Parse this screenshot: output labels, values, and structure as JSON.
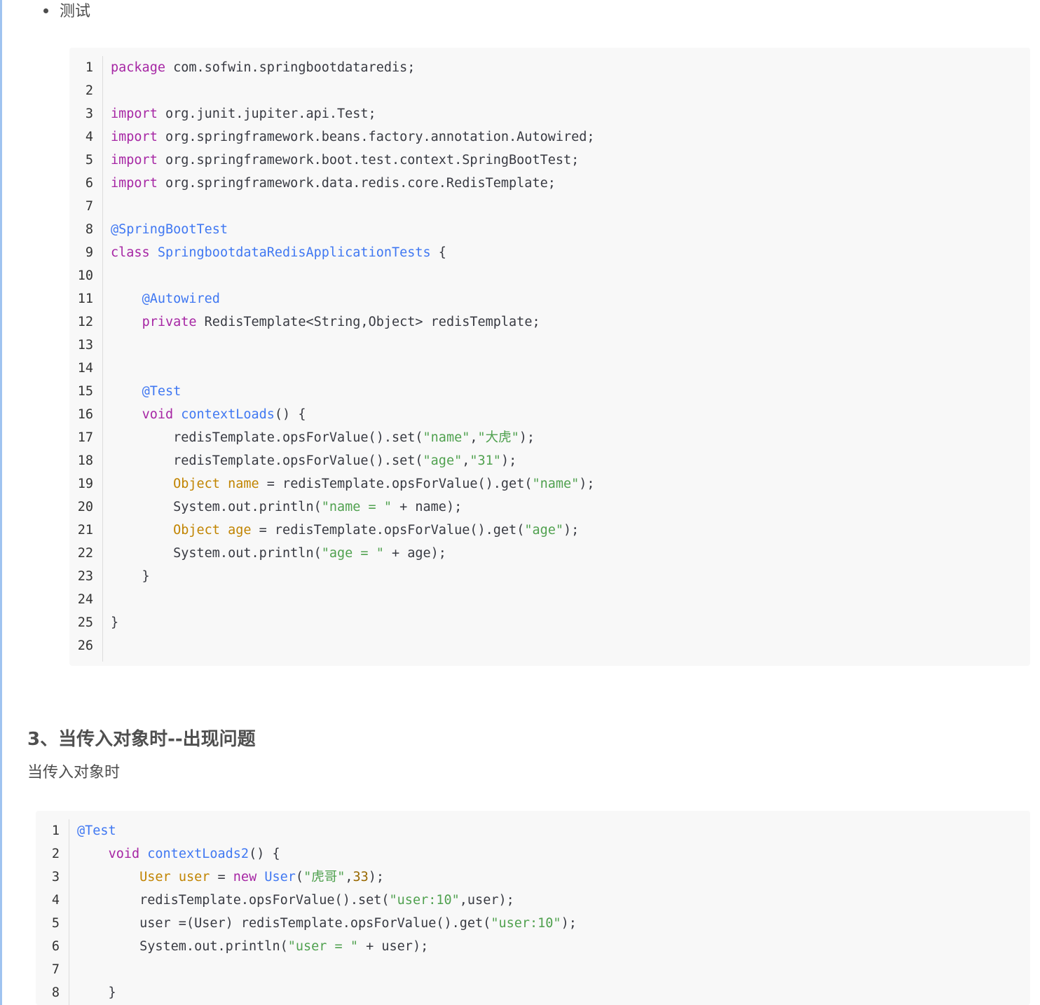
{
  "bullet": {
    "text": "测试"
  },
  "code_block_1": {
    "line_numbers": [
      "1",
      "2",
      "3",
      "4",
      "5",
      "6",
      "7",
      "8",
      "9",
      "10",
      "11",
      "12",
      "13",
      "14",
      "15",
      "16",
      "17",
      "18",
      "19",
      "20",
      "21",
      "22",
      "23",
      "24",
      "25",
      "26"
    ],
    "lines": [
      [
        {
          "t": "kw",
          "v": "package"
        },
        {
          "t": "pl",
          "v": " com.sofwin.springbootdataredis;"
        }
      ],
      [],
      [
        {
          "t": "kw",
          "v": "import"
        },
        {
          "t": "pl",
          "v": " org.junit.jupiter.api.Test;"
        }
      ],
      [
        {
          "t": "kw",
          "v": "import"
        },
        {
          "t": "pl",
          "v": " org.springframework.beans.factory.annotation.Autowired;"
        }
      ],
      [
        {
          "t": "kw",
          "v": "import"
        },
        {
          "t": "pl",
          "v": " org.springframework.boot.test.context.SpringBootTest;"
        }
      ],
      [
        {
          "t": "kw",
          "v": "import"
        },
        {
          "t": "pl",
          "v": " org.springframework.data.redis.core.RedisTemplate;"
        }
      ],
      [],
      [
        {
          "t": "an",
          "v": "@SpringBootTest"
        }
      ],
      [
        {
          "t": "kw",
          "v": "class"
        },
        {
          "t": "pl",
          "v": " "
        },
        {
          "t": "fn",
          "v": "SpringbootdataRedisApplicationTests"
        },
        {
          "t": "pl",
          "v": " {"
        }
      ],
      [],
      [
        {
          "t": "pl",
          "v": "    "
        },
        {
          "t": "an",
          "v": "@Autowired"
        }
      ],
      [
        {
          "t": "pl",
          "v": "    "
        },
        {
          "t": "kw",
          "v": "private"
        },
        {
          "t": "pl",
          "v": " RedisTemplate<String,Object> redisTemplate;"
        }
      ],
      [],
      [],
      [
        {
          "t": "pl",
          "v": "    "
        },
        {
          "t": "an",
          "v": "@Test"
        }
      ],
      [
        {
          "t": "pl",
          "v": "    "
        },
        {
          "t": "kw",
          "v": "void"
        },
        {
          "t": "pl",
          "v": " "
        },
        {
          "t": "fn",
          "v": "contextLoads"
        },
        {
          "t": "pl",
          "v": "() {"
        }
      ],
      [
        {
          "t": "pl",
          "v": "        redisTemplate.opsForValue().set("
        },
        {
          "t": "st",
          "v": "\"name\""
        },
        {
          "t": "pl",
          "v": ","
        },
        {
          "t": "st",
          "v": "\"大虎\""
        },
        {
          "t": "pl",
          "v": ");"
        }
      ],
      [
        {
          "t": "pl",
          "v": "        redisTemplate.opsForValue().set("
        },
        {
          "t": "st",
          "v": "\"age\""
        },
        {
          "t": "pl",
          "v": ","
        },
        {
          "t": "st",
          "v": "\"31\""
        },
        {
          "t": "pl",
          "v": ");"
        }
      ],
      [
        {
          "t": "pl",
          "v": "        "
        },
        {
          "t": "ty",
          "v": "Object"
        },
        {
          "t": "pl",
          "v": " "
        },
        {
          "t": "ty",
          "v": "name"
        },
        {
          "t": "pl",
          "v": " = redisTemplate.opsForValue().get("
        },
        {
          "t": "st",
          "v": "\"name\""
        },
        {
          "t": "pl",
          "v": ");"
        }
      ],
      [
        {
          "t": "pl",
          "v": "        System.out.println("
        },
        {
          "t": "st",
          "v": "\"name = \""
        },
        {
          "t": "pl",
          "v": " + name);"
        }
      ],
      [
        {
          "t": "pl",
          "v": "        "
        },
        {
          "t": "ty",
          "v": "Object"
        },
        {
          "t": "pl",
          "v": " "
        },
        {
          "t": "ty",
          "v": "age"
        },
        {
          "t": "pl",
          "v": " = redisTemplate.opsForValue().get("
        },
        {
          "t": "st",
          "v": "\"age\""
        },
        {
          "t": "pl",
          "v": ");"
        }
      ],
      [
        {
          "t": "pl",
          "v": "        System.out.println("
        },
        {
          "t": "st",
          "v": "\"age = \""
        },
        {
          "t": "pl",
          "v": " + age);"
        }
      ],
      [
        {
          "t": "pl",
          "v": "    }"
        }
      ],
      [],
      [
        {
          "t": "pl",
          "v": "}"
        }
      ],
      []
    ]
  },
  "section": {
    "heading": "3、当传入对象时--出现问题",
    "text": "当传入对象时"
  },
  "code_block_2": {
    "line_numbers": [
      "1",
      "2",
      "3",
      "4",
      "5",
      "6",
      "7",
      "8"
    ],
    "lines": [
      [
        {
          "t": "an",
          "v": "@Test"
        }
      ],
      [
        {
          "t": "pl",
          "v": "    "
        },
        {
          "t": "kw",
          "v": "void"
        },
        {
          "t": "pl",
          "v": " "
        },
        {
          "t": "fn",
          "v": "contextLoads2"
        },
        {
          "t": "pl",
          "v": "() {"
        }
      ],
      [
        {
          "t": "pl",
          "v": "        "
        },
        {
          "t": "ty",
          "v": "User"
        },
        {
          "t": "pl",
          "v": " "
        },
        {
          "t": "ty",
          "v": "user"
        },
        {
          "t": "pl",
          "v": " = "
        },
        {
          "t": "kw",
          "v": "new"
        },
        {
          "t": "pl",
          "v": " "
        },
        {
          "t": "fn",
          "v": "User"
        },
        {
          "t": "pl",
          "v": "("
        },
        {
          "t": "st",
          "v": "\"虎哥\""
        },
        {
          "t": "pl",
          "v": ","
        },
        {
          "t": "nu",
          "v": "33"
        },
        {
          "t": "pl",
          "v": ");"
        }
      ],
      [
        {
          "t": "pl",
          "v": "        redisTemplate.opsForValue().set("
        },
        {
          "t": "st",
          "v": "\"user:10\""
        },
        {
          "t": "pl",
          "v": ",user);"
        }
      ],
      [
        {
          "t": "pl",
          "v": "        user =(User) redisTemplate.opsForValue().get("
        },
        {
          "t": "st",
          "v": "\"user:10\""
        },
        {
          "t": "pl",
          "v": ");"
        }
      ],
      [
        {
          "t": "pl",
          "v": "        System.out.println("
        },
        {
          "t": "st",
          "v": "\"user = \""
        },
        {
          "t": "pl",
          "v": " + user);"
        }
      ],
      [],
      [
        {
          "t": "pl",
          "v": "    }"
        }
      ]
    ]
  },
  "colors": {
    "keyword": "#a626a4",
    "type": "#c18401",
    "function": "#4078f2",
    "annotation": "#4078f2",
    "string": "#50a14f",
    "number": "#986801",
    "code_background": "#f8f8f8"
  }
}
